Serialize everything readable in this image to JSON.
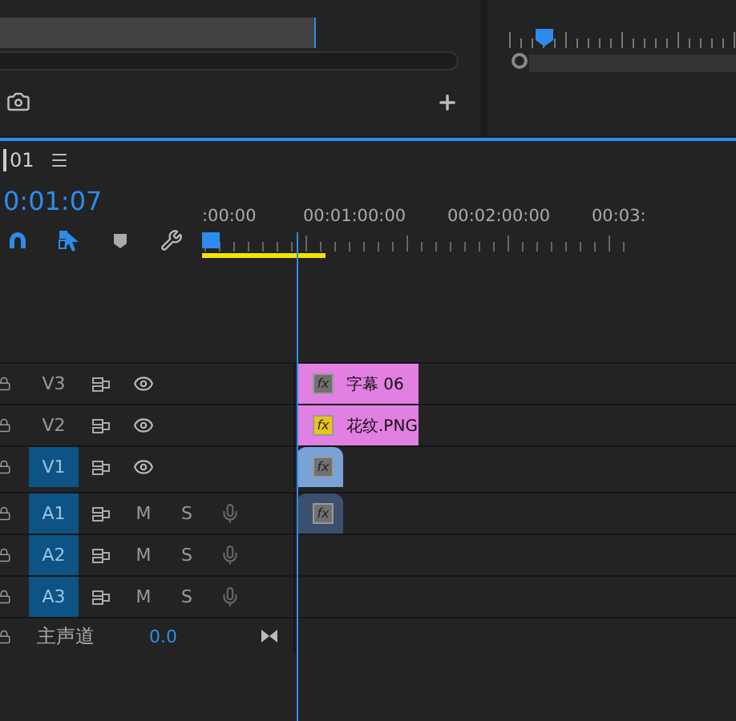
{
  "sequence_tab": {
    "label": "01",
    "selected": true
  },
  "timecode": "0:01:07",
  "ruler_labels": [
    ":00:00",
    "00:01:00:00",
    "00:02:00:00",
    "00:03:"
  ],
  "tracks": [
    {
      "kind": "video",
      "name": "V3",
      "selected": false,
      "clips": [
        {
          "kind": "graphic",
          "label": "字幕 06",
          "badge": "fx",
          "fx_on": false,
          "color": "#e27fe2"
        }
      ]
    },
    {
      "kind": "video",
      "name": "V2",
      "selected": false,
      "clips": [
        {
          "kind": "graphic",
          "label": "花纹.PNG",
          "badge": "fx",
          "fx_on": true,
          "color": "#e27fe2"
        }
      ]
    },
    {
      "kind": "video",
      "name": "V1",
      "selected": true,
      "clips": [
        {
          "kind": "video",
          "badge": "fx",
          "fx_on": false,
          "color": "#79a3d6"
        }
      ]
    },
    {
      "kind": "audio",
      "name": "A1",
      "selected": true,
      "mute": "M",
      "solo": "S",
      "clips": [
        {
          "kind": "audio",
          "badge": "fx",
          "fx_on": false,
          "color": "#3a506e"
        }
      ]
    },
    {
      "kind": "audio",
      "name": "A2",
      "selected": true,
      "mute": "M",
      "solo": "S"
    },
    {
      "kind": "audio",
      "name": "A3",
      "selected": true,
      "mute": "M",
      "solo": "S"
    }
  ],
  "master": {
    "label": "主声道",
    "value": "0.0"
  }
}
